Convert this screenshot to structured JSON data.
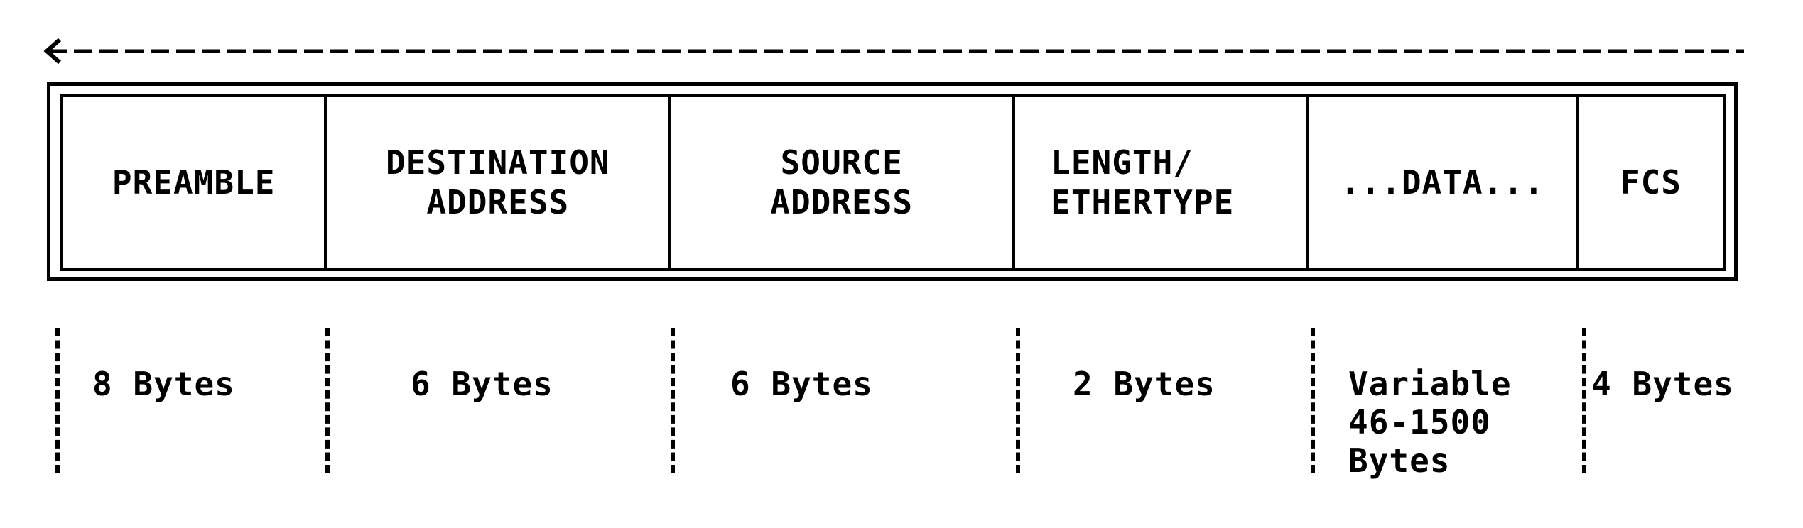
{
  "frame": {
    "fields": [
      {
        "label": "PREAMBLE"
      },
      {
        "label": "DESTINATION\nADDRESS"
      },
      {
        "label": "SOURCE\nADDRESS"
      },
      {
        "label": "LENGTH/\nETHERTYPE"
      },
      {
        "label": "...DATA..."
      },
      {
        "label": "FCS"
      }
    ]
  },
  "sizes": [
    {
      "label": "8 Bytes"
    },
    {
      "label": "6 Bytes"
    },
    {
      "label": "6 Bytes"
    },
    {
      "label": "2 Bytes"
    },
    {
      "label": "Variable\n46-1500\nBytes"
    },
    {
      "label": "4 Bytes"
    }
  ],
  "arrow": {
    "head": "<",
    "direction": "left"
  }
}
